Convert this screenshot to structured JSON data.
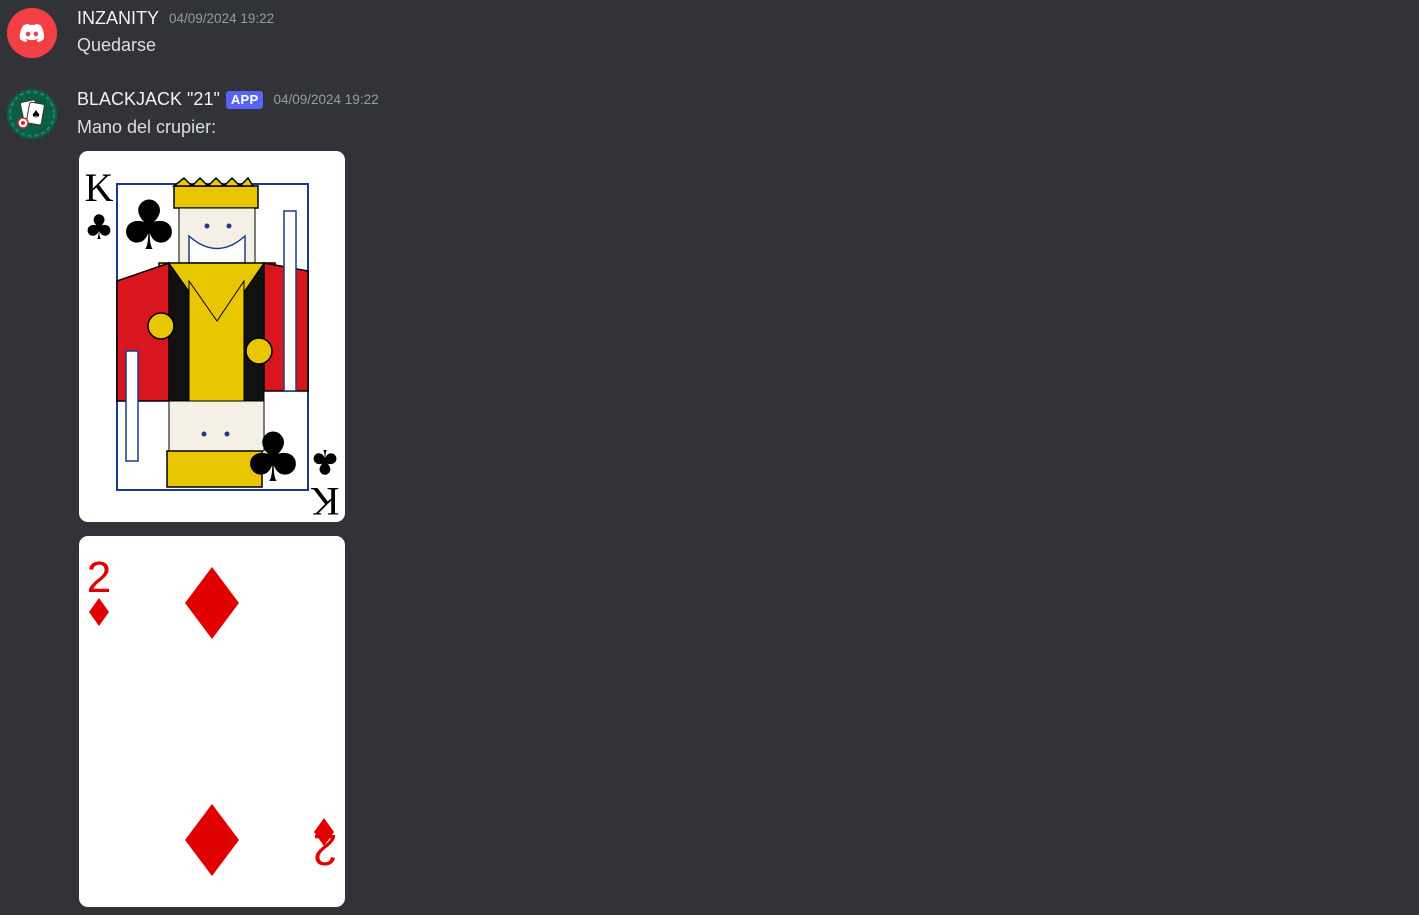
{
  "messages": [
    {
      "author": "INZANITY",
      "timestamp": "04/09/2024 19:22",
      "avatar_icon": "discord-logo-icon",
      "avatar_color": "#f23f43",
      "content": "Quedarse"
    },
    {
      "author": "BLACKJACK \"21\"",
      "badge": "APP",
      "timestamp": "04/09/2024 19:22",
      "avatar_icon": "blackjack-cards-icon",
      "avatar_color": "#0e6b4f",
      "content": "Mano del crupier:",
      "attachments": [
        {
          "rank": "K",
          "suit": "clubs",
          "suit_symbol": "♣",
          "color": "#000000"
        },
        {
          "rank": "2",
          "suit": "diamonds",
          "suit_symbol": "♦",
          "color": "#e00000"
        }
      ]
    }
  ],
  "colors": {
    "background": "#313338",
    "badge": "#5865f2",
    "username": "#f2f3f5",
    "timestamp": "#949ba4"
  }
}
